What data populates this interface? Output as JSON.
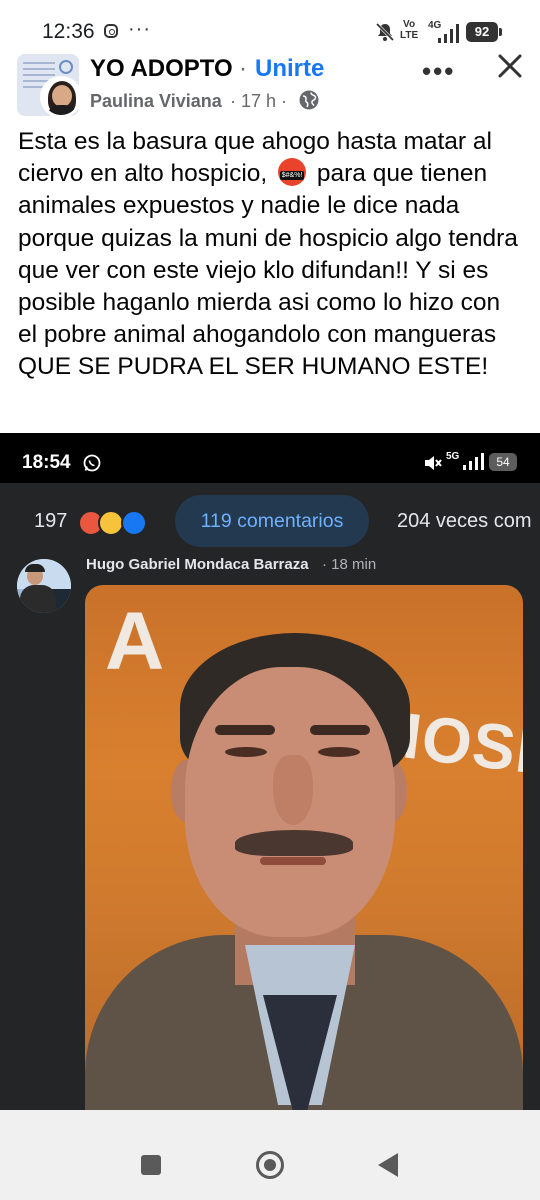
{
  "status_bar": {
    "time": "12:36",
    "dots": "···",
    "volte": "Vo\nLTE",
    "network": "4G",
    "battery": "92"
  },
  "post": {
    "group_name": "YO ADOPTO",
    "separator": "·",
    "join_label": "Unirte",
    "author": "Paulina Viviana",
    "time_ago": "· 17 h ·",
    "more_label": "•••",
    "text_part1": "Esta es la basura que ahogo hasta matar al ciervo en alto hospicio,",
    "emoji_text": "$#&%!",
    "text_part2": " para que tienen animales expuestos y nadie le dice nada porque quizas la muni de hospicio algo tendra que ver con este viejo klo difundan!! Y si es posible haganlo mierda asi como lo hizo con el pobre animal ahogandolo con mangueras QUE SE PUDRA EL SER HUMANO ESTE!"
  },
  "embedded": {
    "status_time": "18:54",
    "network": "5G",
    "battery": "54",
    "reaction_count": "197",
    "comments_label": "119 comentarios",
    "shares_label": "204 veces com",
    "commenter_name": "Hugo Gabriel Mondaca Barraza",
    "comment_time": "· 18 min",
    "photo_sign_left": "A",
    "photo_sign_right": "HOSPIC"
  },
  "colors": {
    "link_blue": "#1877f2",
    "dark_bg": "#242526",
    "pill_bg": "#23394f",
    "pill_text": "#6fb0ff"
  },
  "icons": {
    "header": [
      "instagram-icon",
      "mute-bell-icon",
      "signal-icon",
      "battery-icon"
    ],
    "post": [
      "globe-icon",
      "more-icon",
      "close-icon"
    ],
    "embedded": [
      "whatsapp-icon",
      "mute-icon",
      "angry-reaction-icon",
      "sad-reaction-icon",
      "like-reaction-icon"
    ],
    "nav": [
      "recents-icon",
      "home-icon",
      "back-icon"
    ]
  }
}
